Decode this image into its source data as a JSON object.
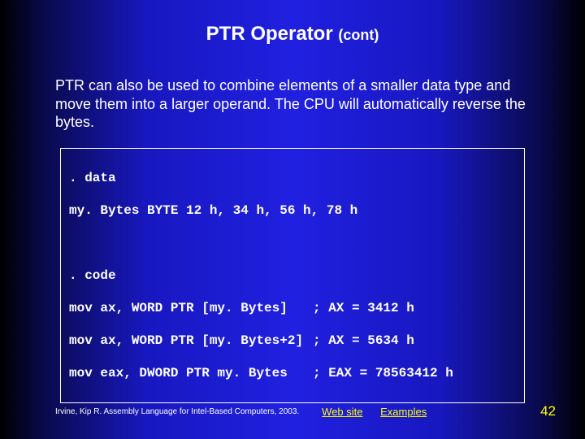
{
  "title": {
    "main": "PTR Operator",
    "sub": "(cont)"
  },
  "body": "PTR can also be used to combine elements of a smaller data type and move them into a larger operand. The CPU will automatically reverse the bytes.",
  "code": {
    "line1": ". data",
    "line2": "my. Bytes BYTE 12 h, 34 h, 56 h, 78 h",
    "blank": "",
    "line3": ". code",
    "row1": {
      "left": "mov ax, WORD PTR [my. Bytes]",
      "right": "; AX = 3412 h"
    },
    "row2": {
      "left": "mov ax, WORD PTR [my. Bytes+2]",
      "right": "; AX = 5634 h"
    },
    "row3": {
      "left": "mov eax, DWORD PTR my. Bytes",
      "right": "; EAX = 78563412 h"
    }
  },
  "footer": {
    "attribution": "Irvine, Kip R. Assembly Language for Intel-Based Computers, 2003.",
    "link1": "Web site",
    "link2": "Examples",
    "page": "42"
  }
}
